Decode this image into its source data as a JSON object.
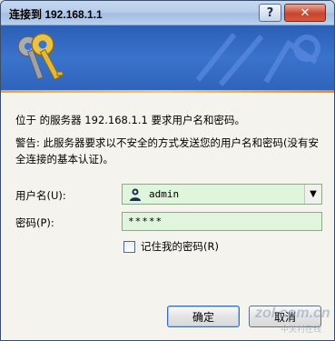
{
  "window": {
    "title": "连接到 192.168.1.1",
    "help_label": "?",
    "close_label": "✕"
  },
  "message": {
    "line1": "位于  的服务器 192.168.1.1 要求用户名和密码。",
    "warning": "警告: 此服务器要求以不安全的方式发送您的用户名和密码(没有安全连接的基本认证)。"
  },
  "form": {
    "username_label": "用户名(U):",
    "username_value": "admin",
    "password_label": "密码(P):",
    "password_value": "*****",
    "remember_label": "记住我的密码(R)",
    "remember_checked": false
  },
  "buttons": {
    "ok_label": "确定",
    "cancel_label": "取消"
  },
  "watermark": {
    "text": "zol.com.cn",
    "subtext": "中关村在线"
  },
  "colors": {
    "banner": "#3a73cc",
    "accent_bar": "#f7c55a",
    "field_fill": "#dff5dc"
  }
}
